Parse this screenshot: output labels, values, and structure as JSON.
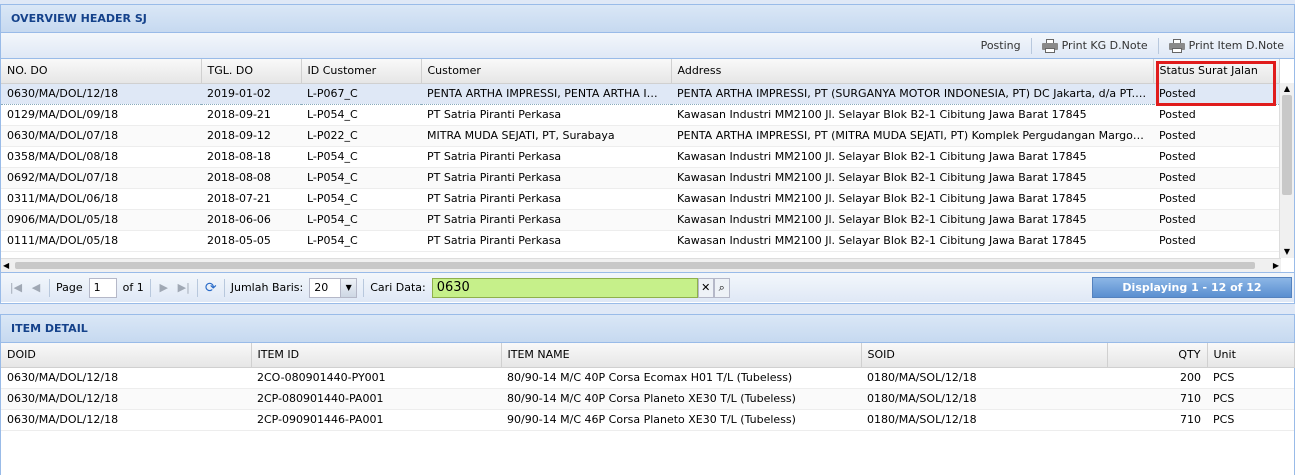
{
  "header_panel": {
    "title": "OVERVIEW HEADER SJ",
    "toolbar": {
      "posting": "Posting",
      "print_kg": "Print KG D.Note",
      "print_item": "Print Item D.Note"
    },
    "columns": [
      "NO. DO",
      "TGL. DO",
      "ID Customer",
      "Customer",
      "Address",
      "Status Surat Jalan"
    ],
    "rows": [
      [
        "0630/MA/DOL/12/18",
        "2019-01-02",
        "L-P067_C",
        "PENTA ARTHA IMPRESSI, PENTA ARTHA IMPR...",
        "PENTA ARTHA IMPRESSI, PT (SURGANYA MOTOR INDONESIA, PT) DC Jakarta, d/a PT. Dirgap...",
        "Posted"
      ],
      [
        "0129/MA/DOL/09/18",
        "2018-09-21",
        "L-P054_C",
        "PT Satria Piranti Perkasa",
        "Kawasan Industri MM2100 Jl. Selayar Blok B2-1 Cibitung Jawa Barat 17845",
        "Posted"
      ],
      [
        "0630/MA/DOL/07/18",
        "2018-09-12",
        "L-P022_C",
        "MITRA MUDA SEJATI, PT, Surabaya",
        "PENTA ARTHA IMPRESSI, PT (MITRA MUDA SEJATI, PT) Komplek Pergudangan Margomulyo P...",
        "Posted"
      ],
      [
        "0358/MA/DOL/08/18",
        "2018-08-18",
        "L-P054_C",
        "PT Satria Piranti Perkasa",
        "Kawasan Industri MM2100 Jl. Selayar Blok B2-1 Cibitung Jawa Barat 17845",
        "Posted"
      ],
      [
        "0692/MA/DOL/07/18",
        "2018-08-08",
        "L-P054_C",
        "PT Satria Piranti Perkasa",
        "Kawasan Industri MM2100 Jl. Selayar Blok B2-1 Cibitung Jawa Barat 17845",
        "Posted"
      ],
      [
        "0311/MA/DOL/06/18",
        "2018-07-21",
        "L-P054_C",
        "PT Satria Piranti Perkasa",
        "Kawasan Industri MM2100 Jl. Selayar Blok B2-1 Cibitung Jawa Barat 17845",
        "Posted"
      ],
      [
        "0906/MA/DOL/05/18",
        "2018-06-06",
        "L-P054_C",
        "PT Satria Piranti Perkasa",
        "Kawasan Industri MM2100 Jl. Selayar Blok B2-1 Cibitung Jawa Barat 17845",
        "Posted"
      ],
      [
        "0111/MA/DOL/05/18",
        "2018-05-05",
        "L-P054_C",
        "PT Satria Piranti Perkasa",
        "Kawasan Industri MM2100 Jl. Selayar Blok B2-1 Cibitung Jawa Barat 17845",
        "Posted"
      ]
    ],
    "pager": {
      "page_label": "Page",
      "page_value": "1",
      "of_label": "of 1",
      "rows_label": "Jumlah Baris:",
      "rows_value": "20",
      "search_label": "Cari Data:",
      "search_value": "0630",
      "displaying": "Displaying 1 - 12 of 12"
    }
  },
  "detail_panel": {
    "title": "ITEM DETAIL",
    "columns": [
      "DOID",
      "ITEM ID",
      "ITEM NAME",
      "SOID",
      "QTY",
      "Unit"
    ],
    "rows": [
      [
        "0630/MA/DOL/12/18",
        "2CO-080901440-PY001",
        "80/90-14 M/C 40P Corsa Ecomax H01 T/L (Tubeless)",
        "0180/MA/SOL/12/18",
        "200",
        "PCS"
      ],
      [
        "0630/MA/DOL/12/18",
        "2CP-080901440-PA001",
        "80/90-14 M/C 40P Corsa Planeto XE30 T/L (Tubeless)",
        "0180/MA/SOL/12/18",
        "710",
        "PCS"
      ],
      [
        "0630/MA/DOL/12/18",
        "2CP-090901446-PA001",
        "90/90-14 M/C 46P Corsa Planeto XE30 T/L (Tubeless)",
        "0180/MA/SOL/12/18",
        "710",
        "PCS"
      ]
    ]
  },
  "colors": {
    "header_text": "#15428b",
    "search_bg": "#c6f08a",
    "highlight": "#e01c1c"
  }
}
